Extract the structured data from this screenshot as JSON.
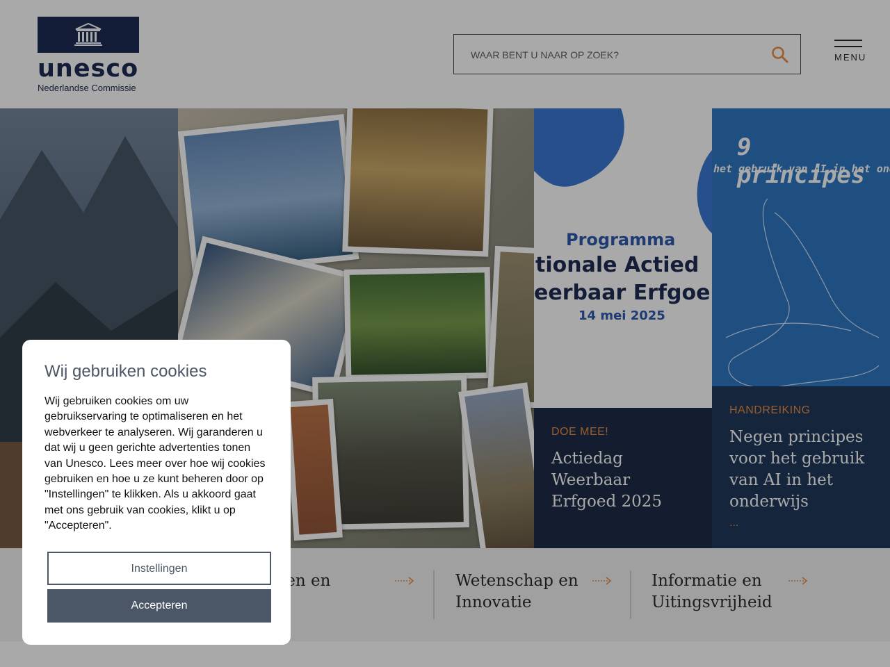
{
  "header": {
    "logo_word": "unesco",
    "logo_sub": "Nederlandse Commissie",
    "search_placeholder": "WAAR BENT U NAAR OP ZOEK?",
    "menu_label": "MENU"
  },
  "hero": {
    "cards": [
      {
        "tag": "",
        "title": "",
        "dots": ""
      },
      {},
      {
        "tag": "DOE MEE!",
        "title": "Actiedag Weerbaar Erfgoed 2025",
        "dots": ""
      },
      {
        "tag": "HANDREIKING",
        "title": "Negen principes voor het gebruik van AI in het onderwijs",
        "dots": "..."
      }
    ],
    "poster_programma": "Programma",
    "poster_line1": "tionale Actied",
    "poster_line2": "eerbaar Erfgoe",
    "poster_date": "14 mei 2025",
    "ai_heading": "9 principes",
    "ai_subheading": "het gebruik van AI in het onder"
  },
  "categories": [
    {
      "label": "nis en en"
    },
    {
      "label": "Wetenschap en Innovatie"
    },
    {
      "label": "Informatie en Uitingsvrijheid"
    }
  ],
  "cookie": {
    "title": "Wij gebruiken cookies",
    "body": "Wij gebruiken cookies om uw gebruikservaring te optimaliseren en het webverkeer te analyseren. Wij garanderen u dat wij u geen gerichte advertenties tonen van Unesco. Lees meer over hoe wij cookies gebruiken en hoe u ze kunt beheren door op \"Instellingen\" te klikken. Als u akkoord gaat met ons gebruik van cookies, klikt u op \"Accepteren\".",
    "settings_label": "Instellingen",
    "accept_label": "Accepteren"
  },
  "colors": {
    "navy": "#0f1e47",
    "accent": "#e9863a",
    "button_grey": "#4b5766",
    "ai_blue": "#1f6fbd"
  }
}
